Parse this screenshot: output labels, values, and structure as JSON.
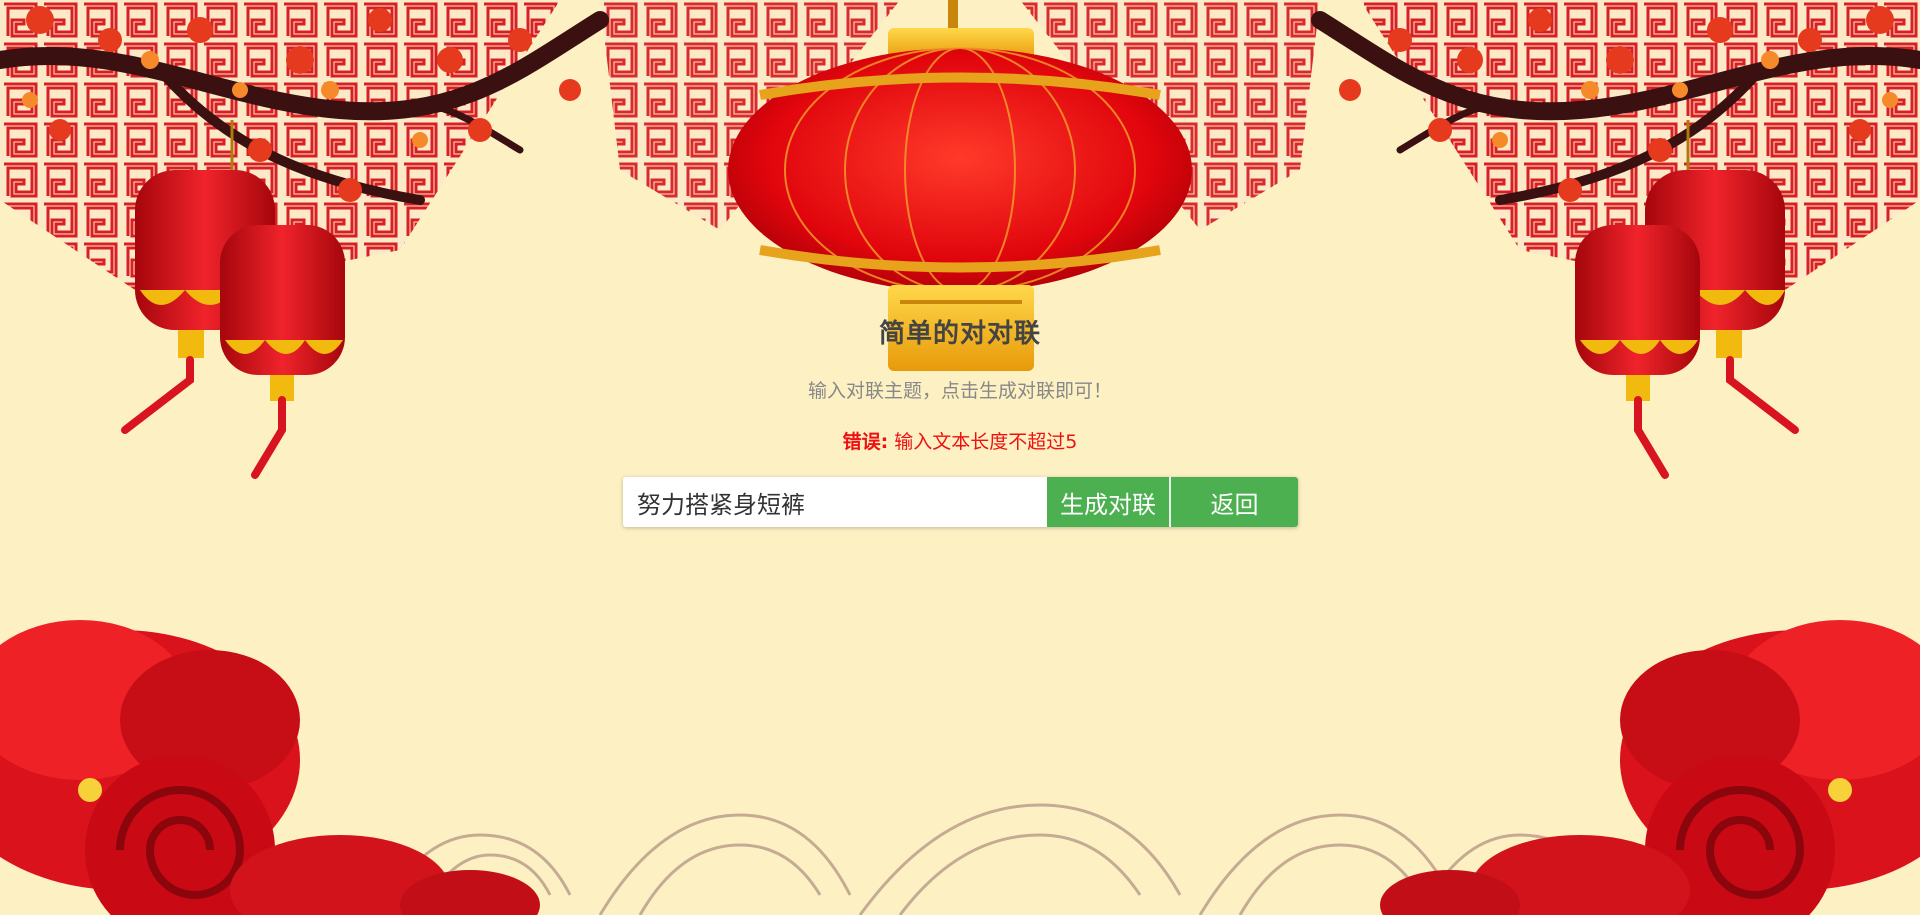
{
  "header": {
    "title": "简单的对对联",
    "subtitle": "输入对联主题，点击生成对联即可！"
  },
  "error": {
    "label": "错误:",
    "message": " 输入文本长度不超过5"
  },
  "form": {
    "input_value": "努力搭紧身短裤",
    "generate_label": "生成对联",
    "back_label": "返回"
  },
  "colors": {
    "background": "#fdf1c4",
    "accent_red": "#e8121a",
    "button_green": "#4caf50",
    "error_red": "#ee1111"
  },
  "icons": [
    "lantern-icon",
    "plum-blossom-branch",
    "peony-flower",
    "cloud-wave-pattern"
  ]
}
